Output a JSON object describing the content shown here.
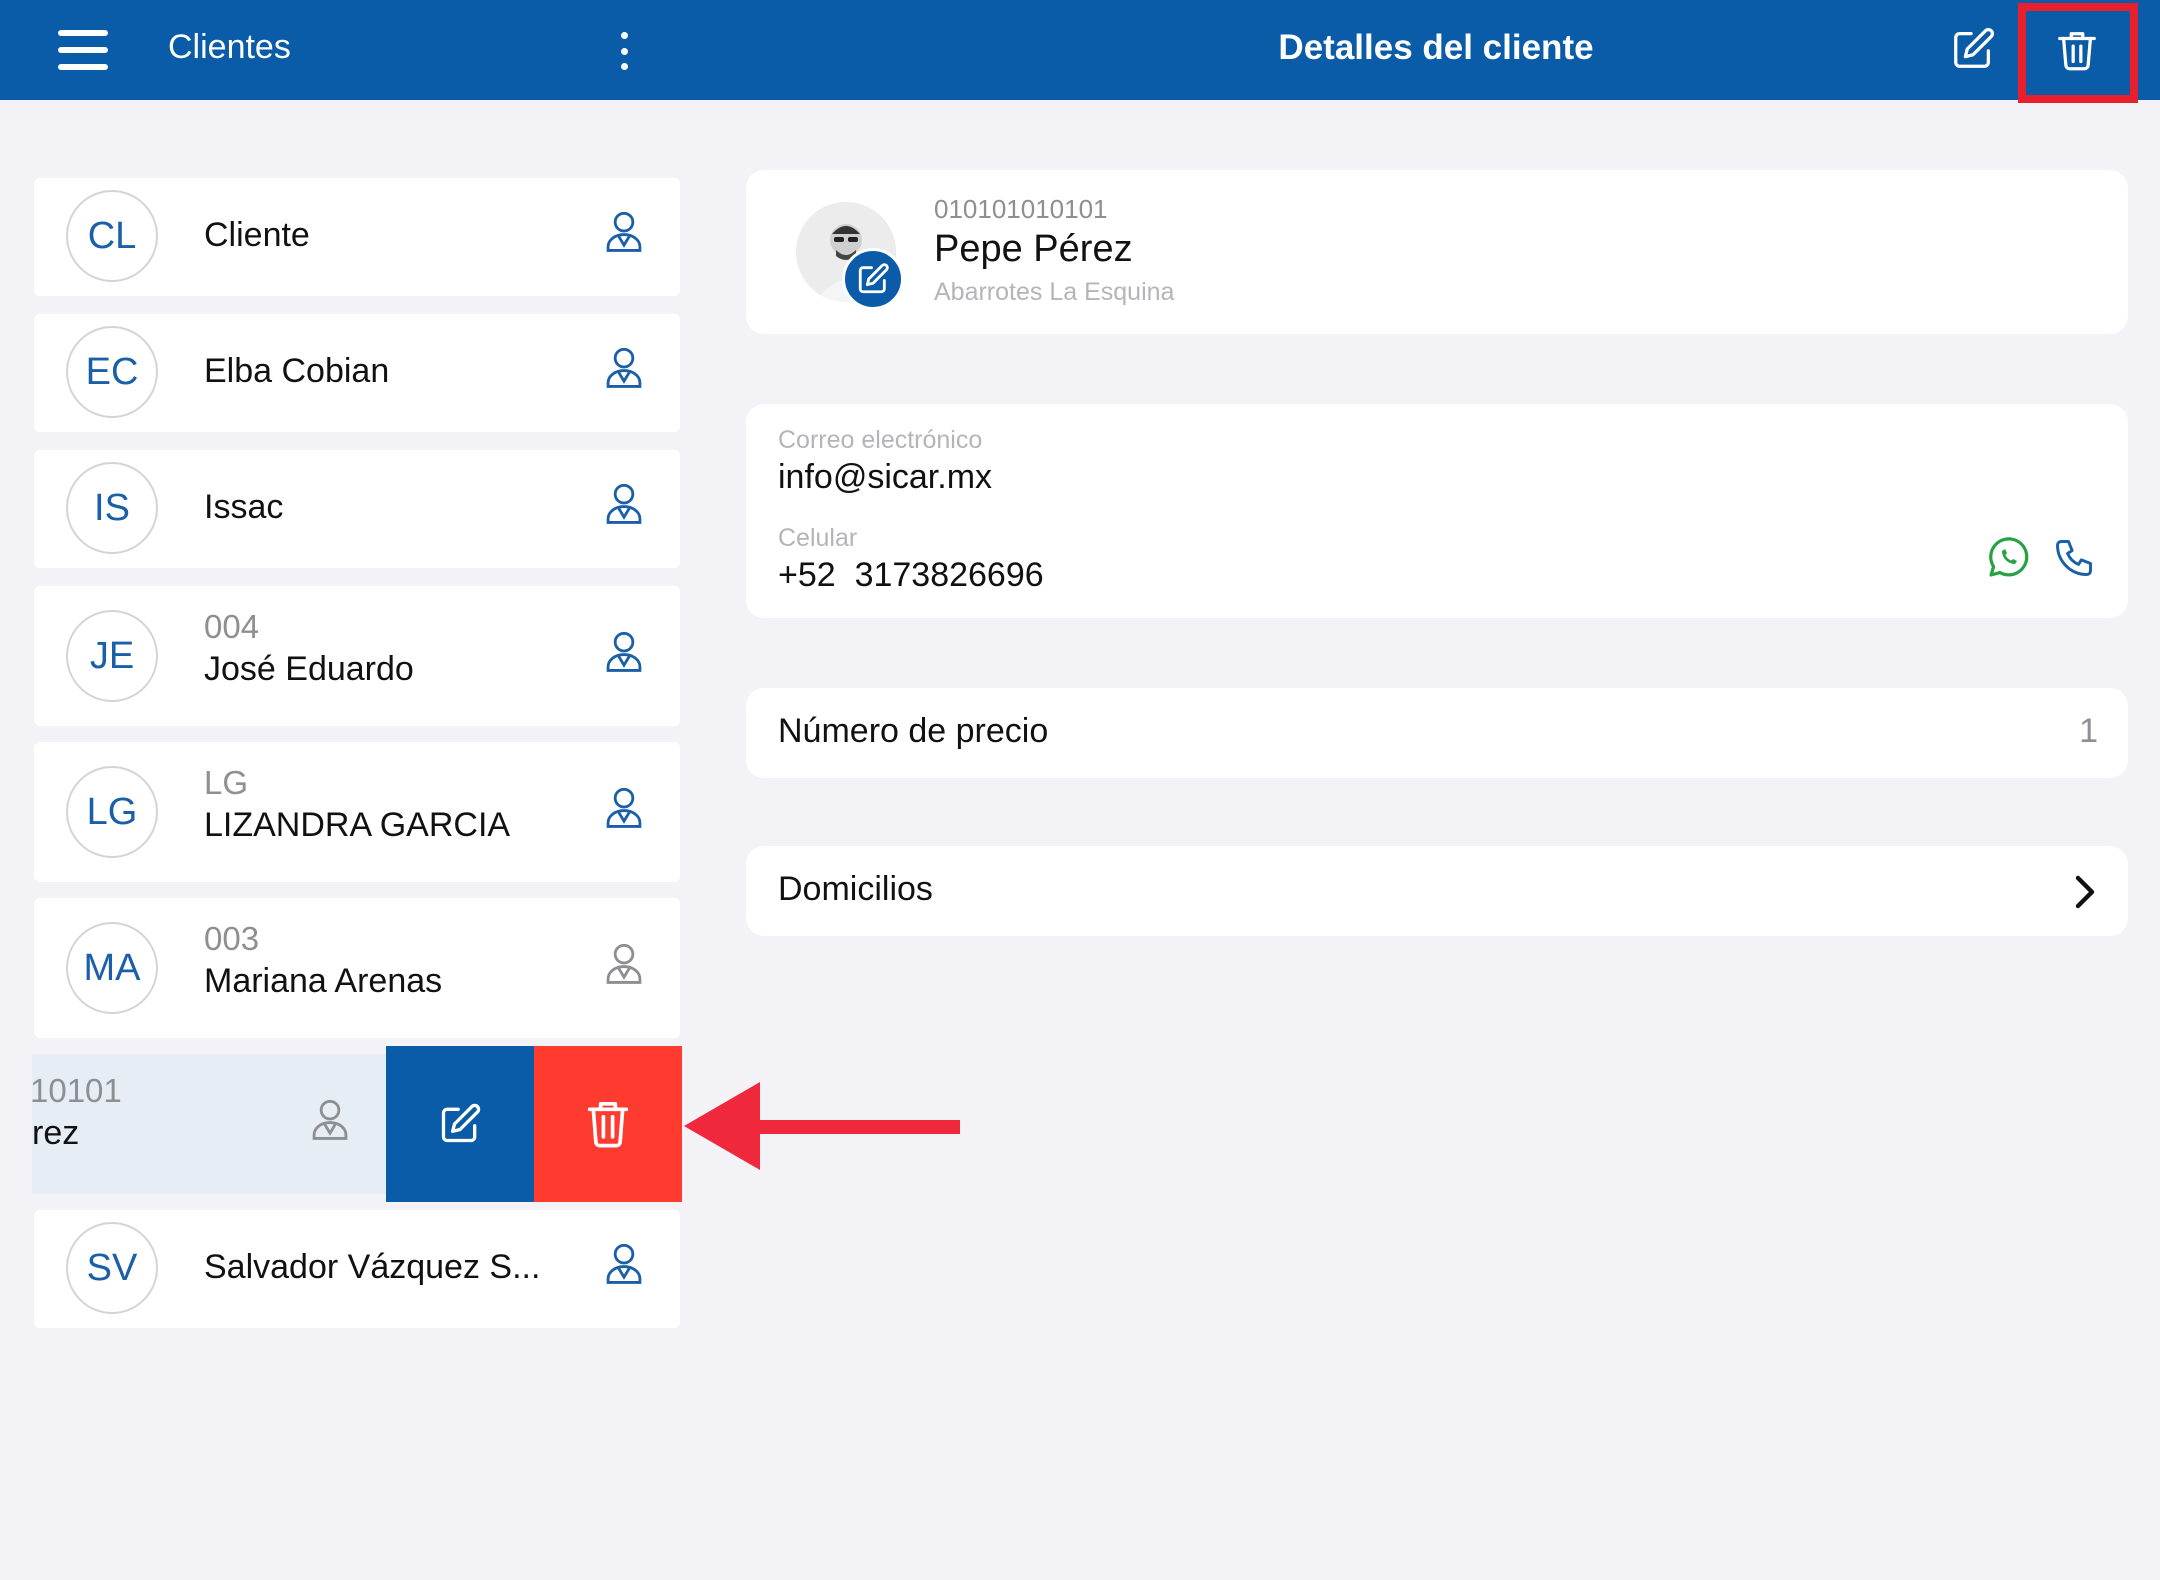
{
  "header": {
    "list_title": "Clientes",
    "detail_title": "Detalles del cliente"
  },
  "icons": {
    "menu": "hamburger-menu-icon",
    "more": "kebab-more-icon",
    "edit": "edit-pencil-square-icon",
    "delete": "trash-icon",
    "person": "person-icon",
    "whatsapp": "whatsapp-icon",
    "phone": "phone-icon",
    "chevron": "chevron-right-icon"
  },
  "colors": {
    "primary": "#0a5ca8",
    "danger": "#ff3b30",
    "highlight": "#e8202e",
    "whatsapp": "#25a244"
  },
  "clients": [
    {
      "initials": "CL",
      "name": "Cliente",
      "code": ""
    },
    {
      "initials": "EC",
      "name": "Elba Cobian",
      "code": ""
    },
    {
      "initials": "IS",
      "name": "Issac",
      "code": ""
    },
    {
      "initials": "JE",
      "name": "José Eduardo",
      "code": "004"
    },
    {
      "initials": "LG",
      "name": "LIZANDRA GARCIA",
      "code": "LG"
    },
    {
      "initials": "MA",
      "name": "Mariana Arenas",
      "code": "003"
    },
    {
      "initials": "",
      "name": "rez",
      "code": "10101",
      "swiped": true
    },
    {
      "initials": "SV",
      "name": "Salvador Vázquez S...",
      "code": ""
    }
  ],
  "detail": {
    "code": "010101010101",
    "name": "Pepe Pérez",
    "business": "Abarrotes La Esquina",
    "email_label": "Correo electrónico",
    "email": "info@sicar.mx",
    "phone_label": "Celular",
    "phone": "+52  3173826696",
    "price_label": "Número de precio",
    "price_value": "1",
    "addresses_label": "Domicilios"
  }
}
